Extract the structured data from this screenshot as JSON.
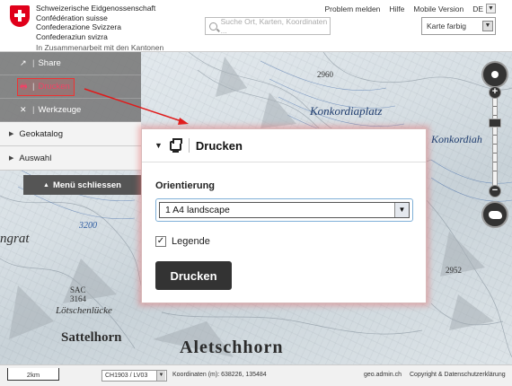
{
  "header": {
    "confederation": [
      "Schweizerische Eidgenossenschaft",
      "Confédération suisse",
      "Confederazione Svizzera",
      "Confederaziun svizra"
    ],
    "cooperation": "In Zusammenarbeit mit den Kantonen",
    "links": [
      "Problem melden",
      "Hilfe",
      "Mobile Version"
    ],
    "language": "DE",
    "search_placeholder": "Suche Ort, Karten, Koordinaten ...",
    "layer_select": "Karte farbig"
  },
  "menu": {
    "items": [
      {
        "label": "Share",
        "icon": "share-icon"
      },
      {
        "label": "Drucken",
        "icon": "printer-icon",
        "active": true
      },
      {
        "label": "Werkzeuge",
        "icon": "tools-icon"
      }
    ],
    "sections": [
      "Geokatalog",
      "Auswahl"
    ],
    "close_label": "Menü schliessen"
  },
  "print_panel": {
    "title": "Drucken",
    "orientation_label": "Orientierung",
    "orientation_value": "1 A4 landscape",
    "legend_label": "Legende",
    "legend_checked": true,
    "print_button": "Drucken"
  },
  "map_labels": {
    "konkordiaplatz": "Konkordiaplatz",
    "konkordiah": "Konkordiah",
    "aletschhorn": "Aletschhorn",
    "salteLhorn": "Sattelhorn",
    "lotschenlucke": "Lötschenlücke",
    "grat": "ngrat",
    "h3200": "3200",
    "h2960": "2960",
    "h3164": "3164",
    "sac": "SAC",
    "h2952": "2952"
  },
  "footer": {
    "scale": "2km",
    "projection": "CH1903 / LV03",
    "coordinates": "Koordinaten (m): 638226, 135484",
    "domain": "geo.admin.ch",
    "copyright": "Copyright & Datenschutzerklärung"
  },
  "colors": {
    "swiss_red": "#e0001a",
    "menu_gray": "#787878",
    "highlight": "#e33333",
    "button_dark": "#333333"
  }
}
